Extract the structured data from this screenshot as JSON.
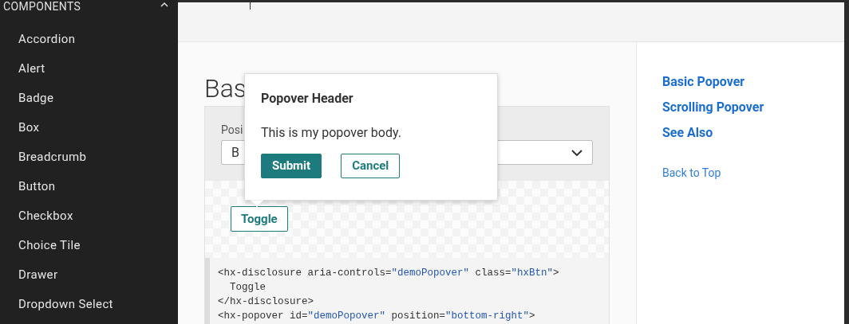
{
  "sidebar": {
    "section": {
      "label": "COMPONENTS",
      "expanded": true
    },
    "items": [
      "Accordion",
      "Alert",
      "Badge",
      "Box",
      "Breadcrumb",
      "Button",
      "Checkbox",
      "Choice Tile",
      "Drawer",
      "Dropdown Select"
    ]
  },
  "heading": "Bas",
  "demo": {
    "field_label": "Posi",
    "select_value": "B",
    "toggle": "Toggle",
    "code": [
      [
        {
          "text": "<hx-disclosure aria-controls=",
          "kind": "plain"
        },
        {
          "text": "\"demoPopover\"",
          "kind": "string"
        },
        {
          "text": " class=",
          "kind": "plain"
        },
        {
          "text": "\"hxBtn\"",
          "kind": "string"
        },
        {
          "text": ">",
          "kind": "plain"
        }
      ],
      [
        {
          "text": "  Toggle",
          "kind": "plain"
        }
      ],
      [
        {
          "text": "</hx-disclosure>",
          "kind": "plain"
        }
      ],
      [
        {
          "text": "<hx-popover id=",
          "kind": "plain"
        },
        {
          "text": "\"demoPopover\"",
          "kind": "string"
        },
        {
          "text": " position=",
          "kind": "plain"
        },
        {
          "text": "\"bottom-right\"",
          "kind": "string"
        },
        {
          "text": ">",
          "kind": "plain"
        }
      ]
    ]
  },
  "popover": {
    "header": "Popover Header",
    "body": "This is my popover body.",
    "buttons": [
      {
        "label": "Submit",
        "kind": "primary"
      },
      {
        "label": "Cancel",
        "kind": "secondary"
      }
    ]
  },
  "toc": {
    "links": [
      "Basic Popover",
      "Scrolling Popover",
      "See Also"
    ],
    "back_to_top": "Back to Top"
  }
}
